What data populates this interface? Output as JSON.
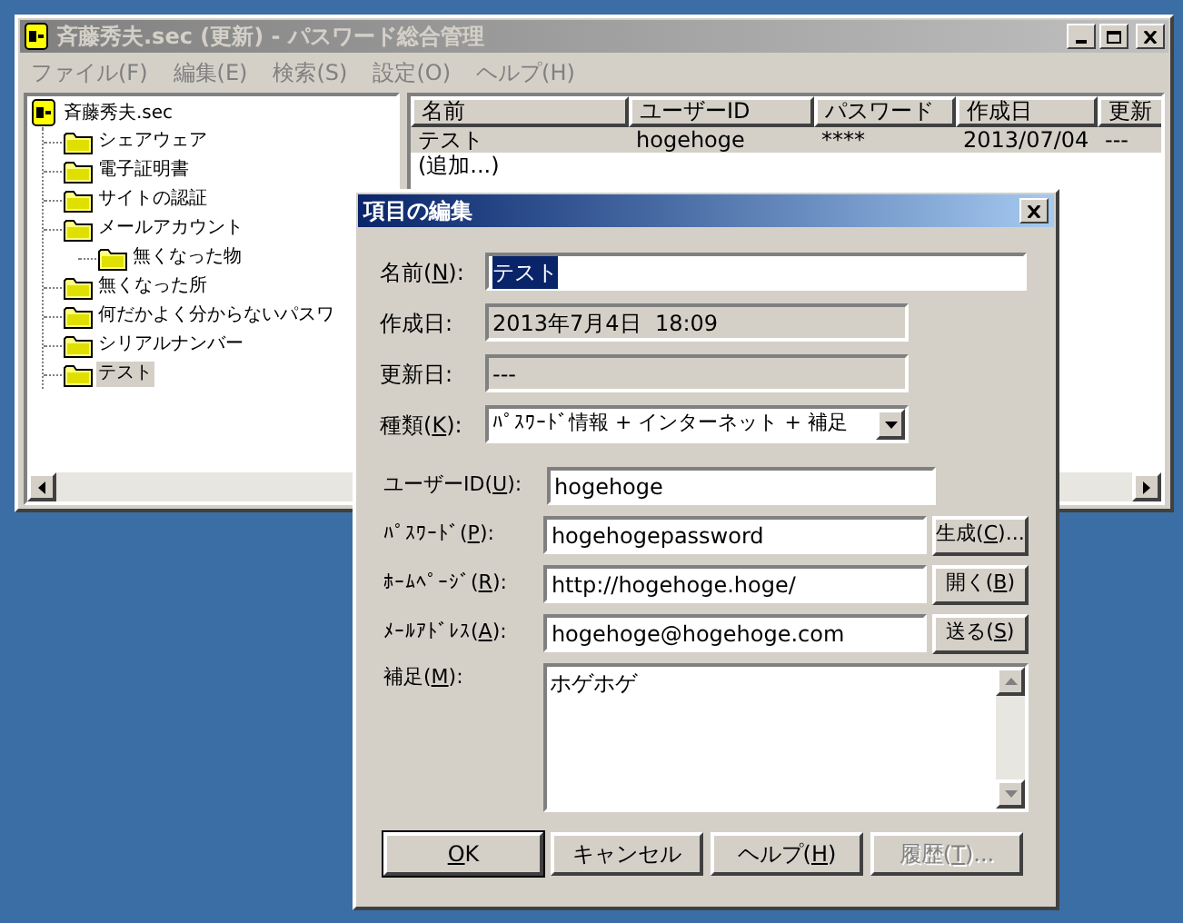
{
  "window": {
    "title": "斉藤秀夫.sec (更新) - パスワード総合管理"
  },
  "menu": [
    "ファイル(F)",
    "編集(E)",
    "検索(S)",
    "設定(O)",
    "ヘルプ(H)"
  ],
  "tree": {
    "label": "斉藤秀夫.sec",
    "children": [
      {
        "label": "シェアウェア",
        "selected": false
      },
      {
        "label": "電子証明書",
        "selected": false
      },
      {
        "label": "サイトの認証",
        "selected": false
      },
      {
        "label": "メールアカウント",
        "selected": false,
        "children": [
          {
            "label": "無くなった物",
            "selected": false
          }
        ]
      },
      {
        "label": "無くなった所",
        "selected": false
      },
      {
        "label": "何だかよく分からないパスワ",
        "selected": false
      },
      {
        "label": "シリアルナンバー",
        "selected": false
      },
      {
        "label": "テスト",
        "selected": true
      }
    ]
  },
  "list": {
    "columns": [
      "名前",
      "ユーザーID",
      "パスワード",
      "作成日",
      "更新"
    ],
    "rows": [
      {
        "cells": [
          "テスト",
          "hogehoge",
          "****",
          "2013/07/04",
          "---"
        ],
        "selected": true
      },
      {
        "cells": [
          "(追加...)"
        ],
        "selected": false
      }
    ]
  },
  "dialog": {
    "title": "項目の編集",
    "top_fields": [
      {
        "kind": "text",
        "label": {
          "before": "名前(",
          "key": "N",
          "after": "):"
        },
        "value": "テスト",
        "text_selected": true
      },
      {
        "kind": "readonly",
        "label": {
          "before": "作成日:"
        },
        "value": "2013年7月4日  18:09"
      },
      {
        "kind": "readonly",
        "label": {
          "before": "更新日:"
        },
        "value": "---"
      },
      {
        "kind": "select",
        "label": {
          "before": "種類(",
          "key": "K",
          "after": "):"
        },
        "value": "ﾊﾟｽﾜｰﾄﾞ情報 + インターネット + 補足"
      }
    ],
    "fields": [
      {
        "label": {
          "before": "ユーザーID(",
          "key": "U",
          "after": "):"
        },
        "value": "hogehoge"
      },
      {
        "label": {
          "before": "ﾊﾟｽﾜｰﾄﾞ(",
          "key": "P",
          "after": "):"
        },
        "value": "hogehogepassword",
        "button": {
          "before": "生成(",
          "key": "C",
          "after": ")..."
        }
      },
      {
        "label": {
          "before": "ﾎｰﾑﾍﾟｰｼﾞ(",
          "key": "R",
          "after": "):"
        },
        "value": "http://hogehoge.hoge/",
        "button": {
          "before": "開く(",
          "key": "B",
          "after": ")"
        }
      },
      {
        "label": {
          "before": "ﾒｰﾙｱﾄﾞﾚｽ(",
          "key": "A",
          "after": "):"
        },
        "value": "hogehoge@hogehoge.com",
        "button": {
          "before": "送る(",
          "key": "S",
          "after": ")"
        }
      }
    ],
    "notes": {
      "label": {
        "before": "補足(",
        "key": "M",
        "after": "):"
      },
      "value": "ホゲホゲ"
    },
    "buttons": [
      {
        "label": {
          "key": "O",
          "after": "K"
        },
        "default": true,
        "disabled": false
      },
      {
        "label": {
          "before": "キャンセル"
        },
        "default": false,
        "disabled": false
      },
      {
        "label": {
          "before": "ヘルプ(",
          "key": "H",
          "after": ")"
        },
        "default": false,
        "disabled": false
      },
      {
        "label": {
          "before": "履歴(",
          "key": "T",
          "after": ")..."
        },
        "default": false,
        "disabled": true
      }
    ]
  }
}
